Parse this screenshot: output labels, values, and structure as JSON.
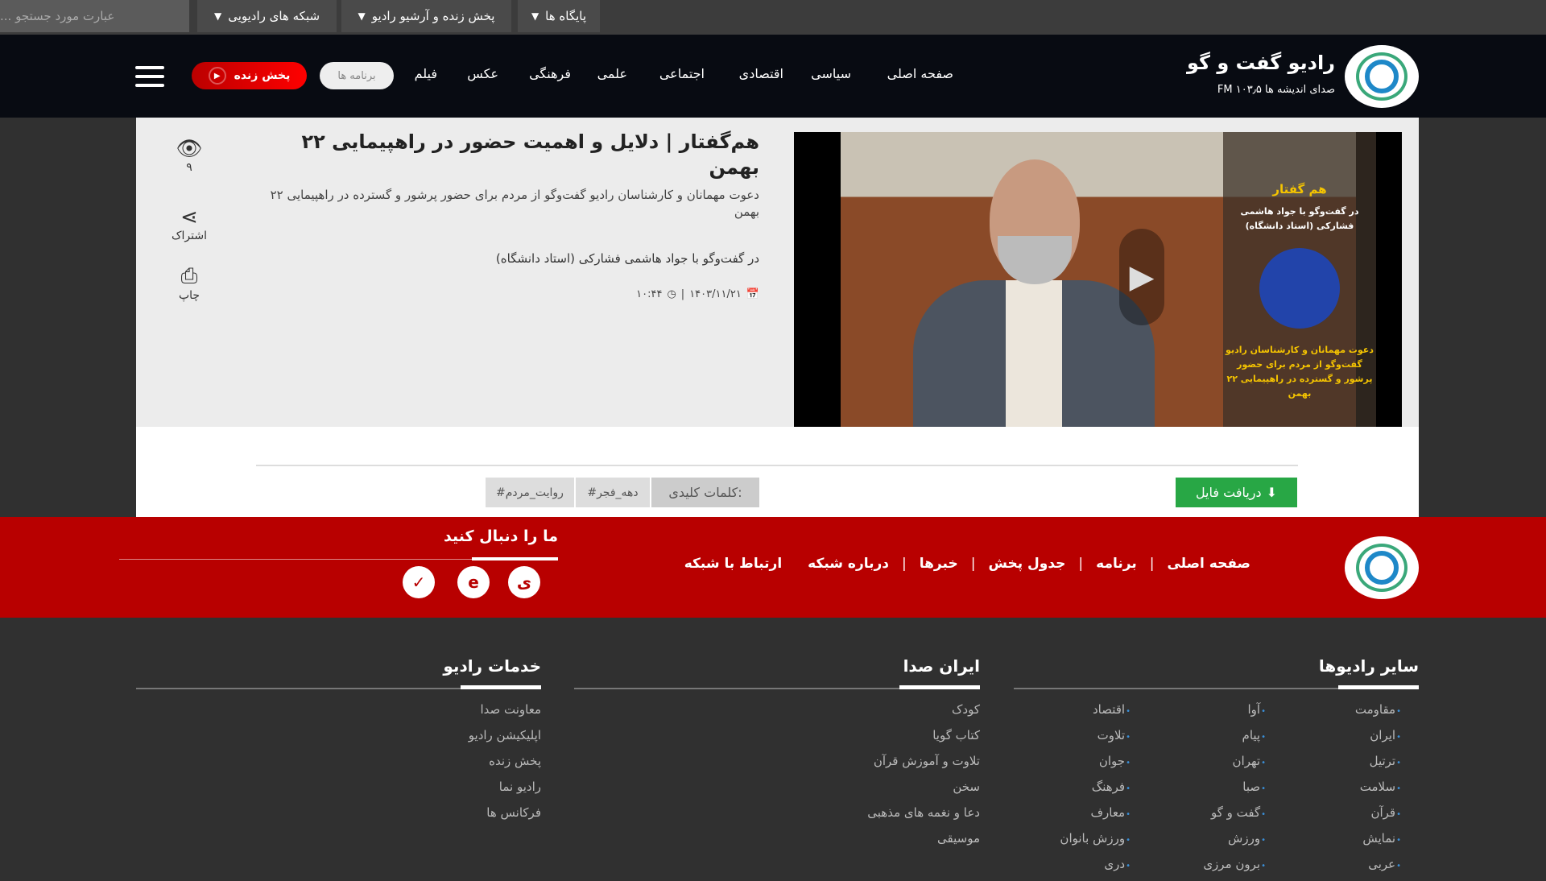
{
  "topbar": {
    "search_placeholder": "عبارت مورد جستجو ...",
    "menus": [
      "شبکه های رادیویی",
      "پخش زنده و آرشیو رادیو",
      "پایگاه ها"
    ]
  },
  "header": {
    "brand_title": "رادیو گفت و گو",
    "brand_subtitle": "صدای اندیشه ها ۱۰۳٫۵ FM",
    "nav": [
      "صفحه اصلی",
      "سیاسی",
      "اقتصادی",
      "اجتماعی",
      "علمی",
      "فرهنگی",
      "عکس",
      "فیلم"
    ],
    "programs_label": "برنامه ها",
    "live_label": "پخش زنده"
  },
  "article": {
    "title": "هم‌گفتار | دلایل و اهمیت حضور در راهپیمایی ۲۲ بهمن",
    "lead": "دعوت مهمانان و کارشناسان رادیو گفت‌وگو از مردم برای حضور پرشور و گسترده در راهپیمایی ۲۲ بهمن",
    "subtitle": "در گفت‌وگو با جواد هاشمی فشارکی (استاد دانشگاه)",
    "date": "۱۴۰۳/۱۱/۲۱",
    "time": "۱۰:۴۴",
    "views": "۹",
    "share_label": "اشتراک",
    "print_label": "چاپ"
  },
  "video": {
    "overlay_heading": "هم گفتار",
    "overlay_guest": "در گفت‌وگو با جواد هاشمی فشارکی (استاد دانشگاه)",
    "overlay_caption": "دعوت مهمانان و کارشناسان رادیو گفت‌وگو از مردم برای حضور پرشور و گسترده در راهپیمایی ۲۲ بهمن"
  },
  "download_label": "دریافت فایل",
  "keywords": {
    "label": "کلمات کلیدی:",
    "tags": [
      "#دهه_فجر",
      "#روایت_مردم"
    ]
  },
  "red_band": {
    "nav": [
      "صفحه اصلی",
      "برنامه",
      "جدول پخش",
      "خبرها",
      "درباره شبکه",
      "ارتباط با شبکه"
    ],
    "follow_label": "ما را دنبال کنید"
  },
  "footer": {
    "radios": {
      "title": "سایر رادیوها",
      "col1": [
        "مقاومت",
        "ایران",
        "ترتیل",
        "سلامت",
        "قرآن",
        "نمایش",
        "عربی"
      ],
      "col2": [
        "آوا",
        "پیام",
        "تهران",
        "صبا",
        "گفت و گو",
        "ورزش",
        "برون مرزی"
      ],
      "col3": [
        "اقتصاد",
        "تلاوت",
        "جوان",
        "فرهنگ",
        "معارف",
        "ورزش بانوان",
        "دری"
      ]
    },
    "iran_seda": {
      "title": "ایران صدا",
      "items": [
        "کودک",
        "کتاب گویا",
        "تلاوت و آموزش قرآن",
        "سخن",
        "دعا و نغمه های مذهبی",
        "موسیقی"
      ]
    },
    "services": {
      "title": "خدمات رادیو",
      "items": [
        "معاونت صدا",
        "اپلیکیشن رادیو",
        "پخش زنده",
        "رادیو نما",
        "فرکانس ها"
      ]
    }
  },
  "colors": {
    "live_red": "#ff0000",
    "band_red": "#b80000",
    "download_green": "#28a745",
    "footer_bg": "#303030",
    "header_bg": "#080b12"
  }
}
